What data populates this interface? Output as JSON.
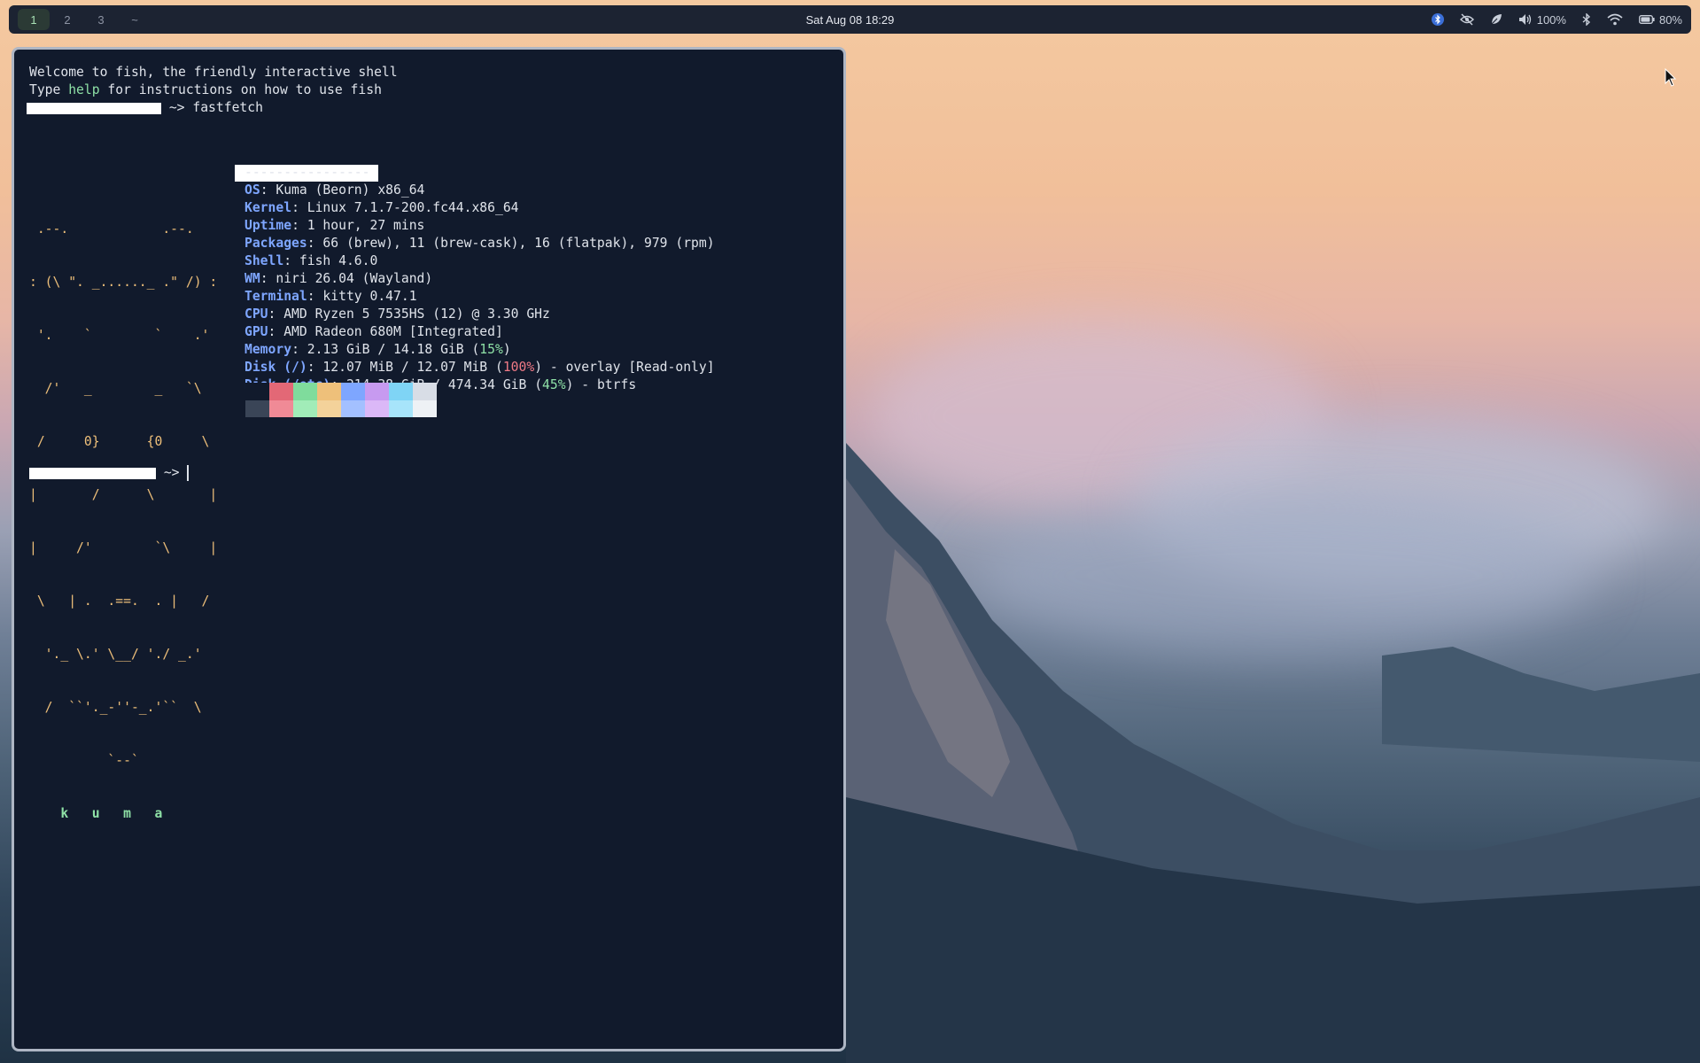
{
  "topbar": {
    "workspaces": [
      {
        "label": "1",
        "active": true
      },
      {
        "label": "2",
        "active": false
      },
      {
        "label": "3",
        "active": false
      },
      {
        "label": "~",
        "active": false
      }
    ],
    "clock": "Sat Aug 08  18:29",
    "tray": {
      "bluetooth_icon": "bluetooth-icon",
      "privacy_icon": "eye-slash-icon",
      "power_profile_icon": "leaf-icon",
      "volume": "100%",
      "bluetooth2_icon": "bluetooth-icon",
      "wifi_icon": "wifi-icon",
      "battery": "80%"
    }
  },
  "terminal": {
    "welcome1": "Welcome to fish, the friendly interactive shell",
    "welcome2_pre": "Type ",
    "welcome2_help": "help",
    "welcome2_post": " for instructions on how to use fish",
    "prompt_arrow": "~>",
    "command": "fastfetch",
    "separator": "----------------",
    "ascii_art": [
      " .--.            .--.",
      ": (\\ \". _......_ .\" /) :",
      " '.    `        `    .'",
      "  /'   _        _   `\\",
      " /     0}      {0     \\",
      "|       /      \\       |",
      "|     /'        `\\     |",
      " \\   | .  .==.  . |   /",
      "  '._ \\.' \\__/ './ _.'",
      "  /  ``'._-''-_.'``  \\",
      "          `--`"
    ],
    "ascii_name": "    k   u   m   a",
    "info": [
      {
        "key": "OS",
        "value": ": Kuma (Beorn) x86_64"
      },
      {
        "key": "Kernel",
        "value": ": Linux 7.1.7-200.fc44.x86_64"
      },
      {
        "key": "Uptime",
        "value": ": 1 hour, 27 mins"
      },
      {
        "key": "Packages",
        "value": ": 66 (brew), 11 (brew-cask), 16 (flatpak), 979 (rpm)"
      },
      {
        "key": "Shell",
        "value": ": fish 4.6.0"
      },
      {
        "key": "WM",
        "value": ": niri 26.04 (Wayland)"
      },
      {
        "key": "Terminal",
        "value": ": kitty 0.47.1"
      },
      {
        "key": "CPU",
        "value": ": AMD Ryzen 5 7535HS (12) @ 3.30 GHz"
      },
      {
        "key": "GPU",
        "value": ": AMD Radeon 680M [Integrated]"
      }
    ],
    "memory": {
      "key": "Memory",
      "pre": ": 2.13 GiB / 14.18 GiB (",
      "pct": "15%",
      "post": ")"
    },
    "disk1": {
      "key": "Disk (/)",
      "pre": ": 12.07 MiB / 12.07 MiB (",
      "pct": "100%",
      "post": ") - overlay [Read-only]"
    },
    "disk2": {
      "key": "Disk (/etc)",
      "pre": ": 214.38 GiB / 474.34 GiB (",
      "pct": "45%",
      "post": ") - btrfs"
    },
    "palette_top": [
      "#111a2c",
      "#e36876",
      "#7fdc9c",
      "#eec07a",
      "#7ea6ff",
      "#c79af0",
      "#7fd4f5",
      "#d8dde6"
    ],
    "palette_bottom": [
      "#3a4557",
      "#f08a96",
      "#a1ecb8",
      "#f3d29a",
      "#a3c0ff",
      "#dbb8f7",
      "#a7e4fa",
      "#eef1f5"
    ]
  }
}
